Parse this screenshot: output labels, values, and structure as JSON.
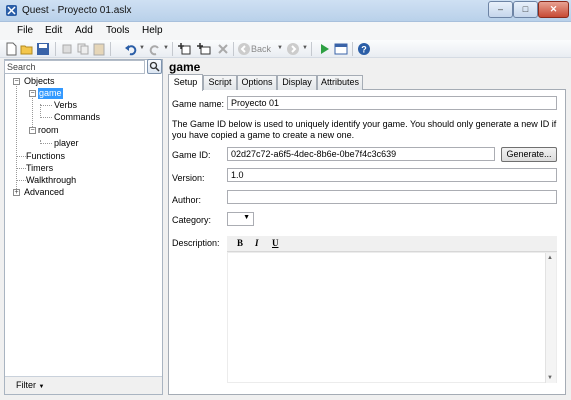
{
  "window": {
    "title": "Quest - Proyecto 01.aslx",
    "icon": "quest-app-icon",
    "minimize_glyph": "–",
    "maximize_glyph": "□",
    "close_glyph": "✕"
  },
  "menu": [
    "File",
    "Edit",
    "Add",
    "Tools",
    "Help"
  ],
  "toolbar": {
    "back_label": "Back",
    "icons": [
      "new-file-icon",
      "open-folder-icon",
      "save-icon",
      "undo-icon",
      "redo-icon",
      "add-object-icon",
      "add-room-icon",
      "delete-icon",
      "cut-icon",
      "copy-icon",
      "paste-icon",
      "back-icon",
      "forward-icon",
      "play-icon",
      "code-view-icon",
      "help-icon"
    ]
  },
  "sidebar": {
    "search_placeholder": "Search",
    "search_icon": "search-icon",
    "tree": {
      "objects": "Objects",
      "game": "game",
      "verbs": "Verbs",
      "commands": "Commands",
      "room": "room",
      "player": "player",
      "functions": "Functions",
      "timers": "Timers",
      "walkthrough": "Walkthrough",
      "advanced": "Advanced"
    },
    "filter_label": "Filter"
  },
  "editor": {
    "title": "game",
    "tabs": [
      "Setup",
      "Script",
      "Options",
      "Display",
      "Attributes"
    ],
    "active_tab": "Setup",
    "game_name_label": "Game name:",
    "game_name_value": "Proyecto 01",
    "info_text": "The Game ID below is used to uniquely identify your game. You should only generate a new ID if you have copied a game to create a new one.",
    "game_id_label": "Game ID:",
    "game_id_value": "02d27c72-a6f5-4dec-8b6e-0be7f4c3c639",
    "generate_button": "Generate...",
    "version_label": "Version:",
    "version_value": "1.0",
    "author_label": "Author:",
    "author_value": "",
    "category_label": "Category:",
    "category_value": "",
    "description_label": "Description:",
    "format_bold": "B",
    "format_italic": "I",
    "format_underline": "U"
  }
}
